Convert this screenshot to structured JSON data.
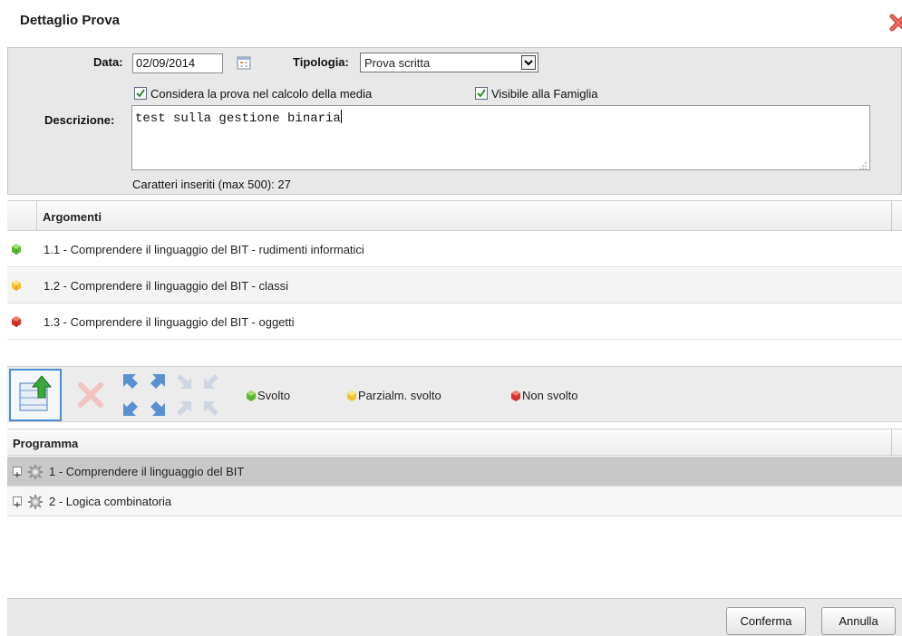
{
  "dialog": {
    "title": "Dettaglio Prova",
    "close_icon": "close-x-icon"
  },
  "form": {
    "date_label": "Data:",
    "date_value": "02/09/2014",
    "type_label": "Tipologia:",
    "type_value": "Prova scritta",
    "checkbox_media_label": "Considera la prova nel calcolo della media",
    "checkbox_media_checked": true,
    "checkbox_famiglia_label": "Visibile alla Famiglia",
    "checkbox_famiglia_checked": true,
    "description_label": "Descrizione:",
    "description_value": "test sulla gestione binaria",
    "char_count": "Caratteri inseriti (max 500): 27"
  },
  "argomenti": {
    "header": "Argomenti",
    "rows": [
      {
        "status": "green",
        "text": "1.1 - Comprendere il linguaggio del BIT - rudimenti informatici"
      },
      {
        "status": "yellow",
        "text": "1.2 - Comprendere il linguaggio del BIT - classi"
      },
      {
        "status": "red",
        "text": "1.3 - Comprendere il linguaggio del BIT - oggetti"
      }
    ]
  },
  "toolbar": {
    "buttons": [
      "import-arrow-icon",
      "delete-x-icon",
      "expand-arrows-icon",
      "collapse-arrows-icon"
    ],
    "legend": {
      "svolto": "Svolto",
      "parzialm": "Parzialm. svolto",
      "non_svolto": "Non svolto"
    }
  },
  "programma": {
    "header": "Programma",
    "items": [
      {
        "text": "1 - Comprendere il linguaggio del BIT",
        "selected": true
      },
      {
        "text": "2 - Logica combinatoria",
        "selected": false
      }
    ]
  },
  "footer": {
    "confirm_label": "Conferma",
    "cancel_label": "Annulla"
  },
  "colors": {
    "green": "#5cb82e",
    "yellow": "#f2c12e",
    "red": "#d9302a",
    "accent_blue": "#4a90d0"
  }
}
